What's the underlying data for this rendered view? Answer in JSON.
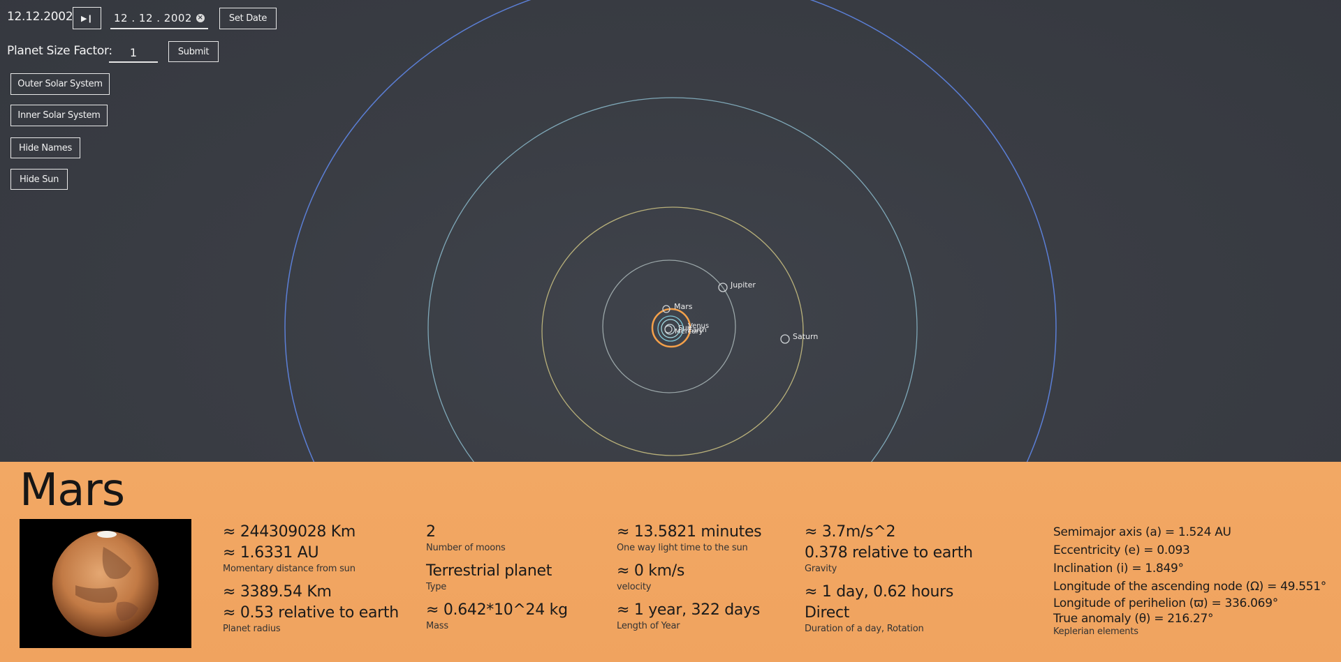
{
  "controls": {
    "current_date": "12.12.2002",
    "play_icon": "play-pause-icon",
    "date_input_value": "12 . 12 . 2002",
    "set_date_label": "Set Date",
    "size_factor_label": "Planet Size Factor:",
    "size_factor_value": "1",
    "submit_label": "Submit",
    "outer_label": "Outer Solar System",
    "inner_label": "Inner Solar System",
    "hide_names_label": "Hide Names",
    "hide_sun_label": "Hide Sun"
  },
  "planets": {
    "mars": "Mars",
    "jupiter": "Jupiter",
    "saturn": "Saturn",
    "venus": "Venus",
    "sun": "Sun",
    "earth": "Earth",
    "mercury": "Mercury"
  },
  "colors": {
    "orbit_outer": "#5b7fd6",
    "orbit_uranus": "#7fa8b8",
    "orbit_saturn": "#b8b07a",
    "orbit_jupiter": "#9aa6a8",
    "orbit_mars": "#f5a14a",
    "orbit_inner": "#7fc8d8",
    "panel_bg": "#f2a864"
  },
  "info": {
    "name": "Mars",
    "distance_km": "≈ 244309028 Km",
    "distance_au": "≈ 1.6331 AU",
    "distance_label": "Momentary distance from sun",
    "radius_km": "≈ 3389.54 Km",
    "radius_rel": "≈ 0.53 relative to earth",
    "radius_label": "Planet radius",
    "moons": "2",
    "moons_label": "Number of moons",
    "type": "Terrestrial planet",
    "type_label": "Type",
    "mass": "≈ 0.642*10^24 kg",
    "mass_label": "Mass",
    "light_time": "≈ 13.5821 minutes",
    "light_time_label": "One way light time to the sun",
    "velocity": "≈ 0 km/s",
    "velocity_label": "velocity",
    "year": "≈ 1 year, 322 days",
    "year_label": "Length of Year",
    "gravity": "≈ 3.7m/s^2",
    "gravity_rel": "0.378 relative to earth",
    "gravity_label": "Gravity",
    "day": "≈ 1 day, 0.62 hours",
    "rotation": "Direct",
    "day_label": "Duration of a day, Rotation",
    "kep_a": "Semimajor axis (a) = 1.524 AU",
    "kep_e": "Eccentricity (e) = 0.093",
    "kep_i": "Inclination (i) = 1.849°",
    "kep_node": "Longitude of the ascending node (Ω)  = 49.551°",
    "kep_peri": "Longitude of perihelion (ϖ) = 336.069°",
    "kep_anom": "True anomaly (θ) = 216.27°",
    "kep_label": "Keplerian elements"
  }
}
